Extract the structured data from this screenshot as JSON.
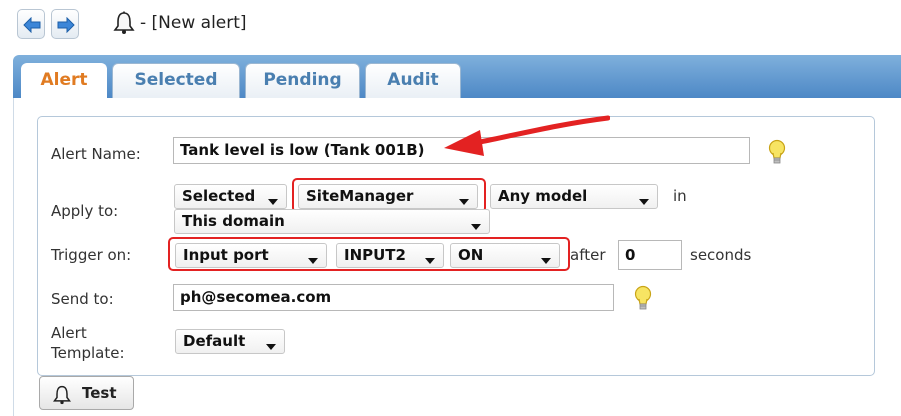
{
  "window": {
    "title": "- [New alert]"
  },
  "tabs": [
    {
      "label": "Alert",
      "active": true
    },
    {
      "label": "Selected"
    },
    {
      "label": "Pending"
    },
    {
      "label": "Audit"
    }
  ],
  "form": {
    "alert_name": {
      "label": "Alert Name:",
      "value": "Tank level is low (Tank 001B)"
    },
    "apply_to": {
      "label": "Apply to:",
      "selection_value": "Selected",
      "device_value": "SiteManager",
      "model_value": "Any model",
      "in_text": "in",
      "domain_value": "This domain"
    },
    "trigger_on": {
      "label": "Trigger on:",
      "type_value": "Input port",
      "port_value": "INPUT2",
      "state_value": "ON",
      "after_text": "after",
      "delay_value": "0",
      "seconds_text": "seconds"
    },
    "send_to": {
      "label": "Send to:",
      "value": "ph@secomea.com"
    },
    "template": {
      "label_line1": "Alert",
      "label_line2": "Template:",
      "value": "Default"
    }
  },
  "test_button": {
    "label": "Test"
  },
  "colors": {
    "tabstrip": "#4d88c6",
    "active_tab_text": "#e07b22",
    "inactive_tab_text": "#4a7fb0",
    "highlight_red": "#e32222"
  },
  "icons": [
    "back-arrow-icon",
    "forward-arrow-icon",
    "bell-icon",
    "lightbulb-icon",
    "annotation-arrow"
  ]
}
